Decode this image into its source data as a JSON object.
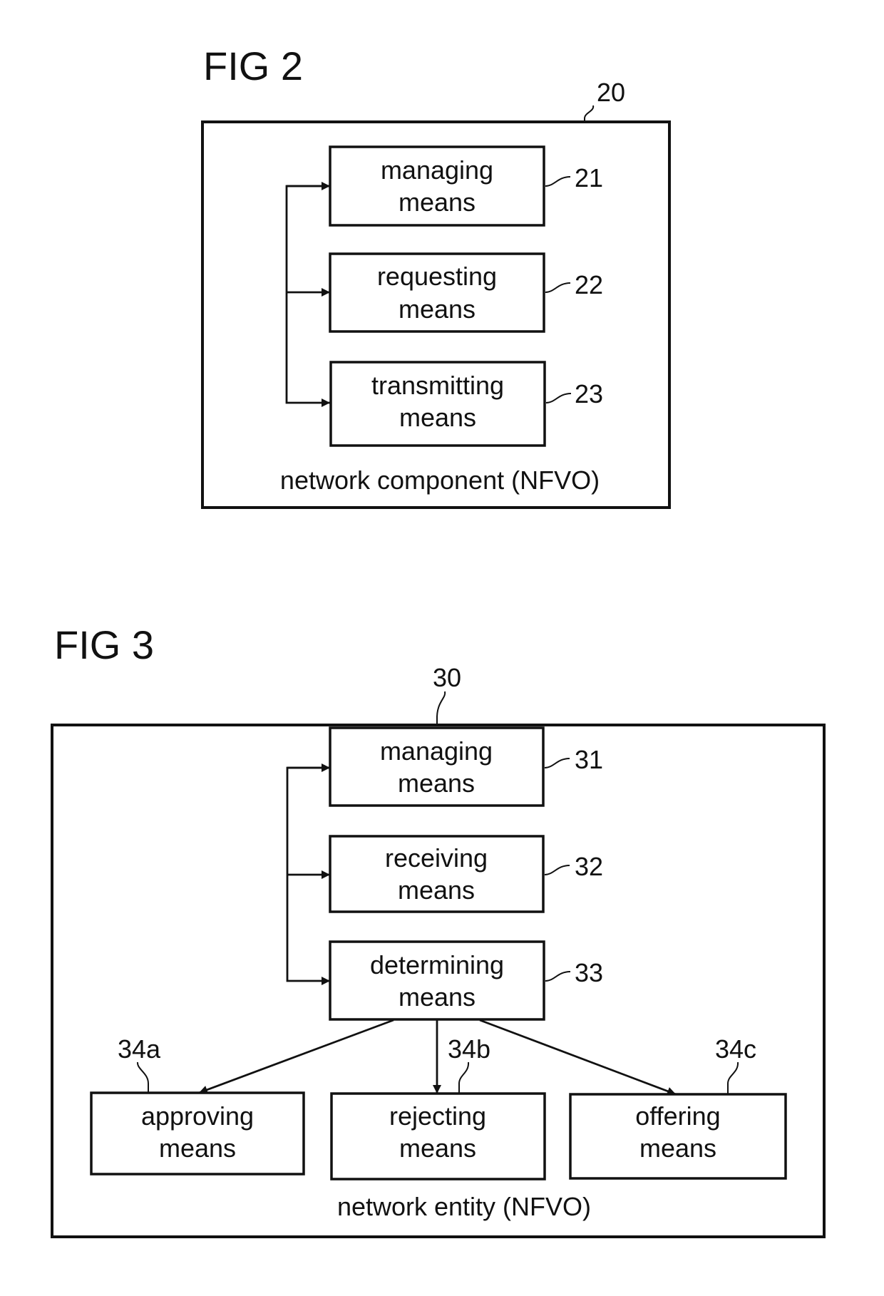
{
  "figures": [
    {
      "title": "FIG 2",
      "ref": "20",
      "container_label": "network component (NFVO)",
      "blocks": [
        {
          "ref": "21",
          "line1": "managing",
          "line2": "means"
        },
        {
          "ref": "22",
          "line1": "requesting",
          "line2": "means"
        },
        {
          "ref": "23",
          "line1": "transmitting",
          "line2": "means"
        }
      ]
    },
    {
      "title": "FIG 3",
      "ref": "30",
      "container_label": "network entity (NFVO)",
      "blocks": [
        {
          "ref": "31",
          "line1": "managing",
          "line2": "means"
        },
        {
          "ref": "32",
          "line1": "receiving",
          "line2": "means"
        },
        {
          "ref": "33",
          "line1": "determining",
          "line2": "means"
        }
      ],
      "outputs": [
        {
          "ref": "34a",
          "line1": "approving",
          "line2": "means"
        },
        {
          "ref": "34b",
          "line1": "rejecting",
          "line2": "means"
        },
        {
          "ref": "34c",
          "line1": "offering",
          "line2": "means"
        }
      ]
    }
  ]
}
